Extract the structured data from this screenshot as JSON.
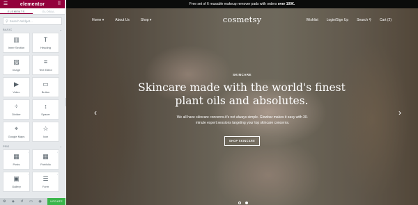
{
  "editor": {
    "brand": "elementor",
    "tabs": [
      "ELEMENTS",
      "GLOBAL"
    ],
    "search_placeholder": "Search Widget...",
    "categories": [
      {
        "label": "BASIC",
        "widgets": [
          {
            "label": "Inner Section",
            "icon": "columns-icon",
            "glyph": "▥"
          },
          {
            "label": "Heading",
            "icon": "heading-icon",
            "glyph": "T"
          },
          {
            "label": "Image",
            "icon": "image-icon",
            "glyph": "▨"
          },
          {
            "label": "Text Editor",
            "icon": "text-editor-icon",
            "glyph": "≡"
          },
          {
            "label": "Video",
            "icon": "video-icon",
            "glyph": "▶"
          },
          {
            "label": "Button",
            "icon": "button-icon",
            "glyph": "▭"
          },
          {
            "label": "Divider",
            "icon": "divider-icon",
            "glyph": "÷"
          },
          {
            "label": "Spacer",
            "icon": "spacer-icon",
            "glyph": "↕"
          },
          {
            "label": "Google Maps",
            "icon": "map-pin-icon",
            "glyph": "⌖"
          },
          {
            "label": "Icon",
            "icon": "star-icon",
            "glyph": "☆"
          }
        ]
      },
      {
        "label": "PRO",
        "widgets": [
          {
            "label": "Posts",
            "icon": "posts-icon",
            "glyph": "▦"
          },
          {
            "label": "Portfolio",
            "icon": "portfolio-icon",
            "glyph": "▦"
          },
          {
            "label": "Gallery",
            "icon": "gallery-icon",
            "glyph": "▣"
          },
          {
            "label": "Form",
            "icon": "form-icon",
            "glyph": "☰"
          }
        ]
      }
    ],
    "footer": {
      "update_label": "UPDATE"
    },
    "colors": {
      "brand": "#93003c",
      "update": "#39b54a"
    }
  },
  "site": {
    "promo_prefix": "Free set of 6 reusable makeup remover pads with orders ",
    "promo_bold": "over 100€.",
    "logo": "cosmetsy",
    "nav_left": [
      "Home",
      "About Us",
      "Shop"
    ],
    "nav_right": [
      "Wishlist",
      "Login/Sign Up",
      "Search",
      "Cart (2)"
    ],
    "hero": {
      "eyebrow": "SKINCARE",
      "title": "Skincare made with the world's finest plant oils and absolutes.",
      "subtitle": "We all have skincare concerns-it's not always simple. Glowbar makes it easy with 30-minute expert sessions targeting your top skincare concerns.",
      "cta": "SHOP SKINCARE"
    },
    "slider": {
      "slide_count": 2,
      "active_slide": 1
    }
  }
}
